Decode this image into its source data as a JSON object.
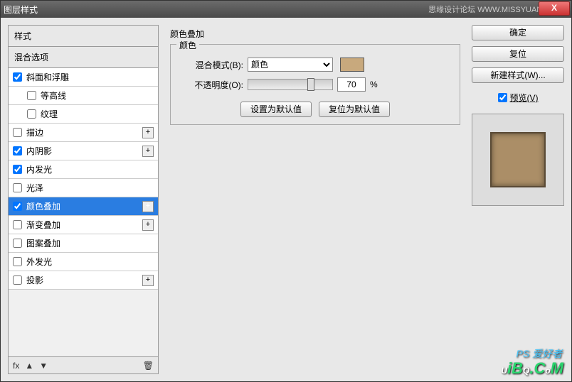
{
  "titlebar": {
    "title": "图层样式",
    "brand": "思缘设计论坛  WWW.MISSYUAN.COM",
    "close": "X"
  },
  "left": {
    "header": "样式",
    "blendopt": "混合选项",
    "items": [
      {
        "label": "斜面和浮雕",
        "checked": true,
        "add": false
      },
      {
        "label": "等高线",
        "checked": false,
        "add": false,
        "indent": true
      },
      {
        "label": "纹理",
        "checked": false,
        "add": false,
        "indent": true
      },
      {
        "label": "描边",
        "checked": false,
        "add": true
      },
      {
        "label": "内阴影",
        "checked": true,
        "add": true
      },
      {
        "label": "内发光",
        "checked": true,
        "add": false
      },
      {
        "label": "光泽",
        "checked": false,
        "add": false
      },
      {
        "label": "颜色叠加",
        "checked": true,
        "add": true,
        "selected": true
      },
      {
        "label": "渐变叠加",
        "checked": false,
        "add": true
      },
      {
        "label": "图案叠加",
        "checked": false,
        "add": false
      },
      {
        "label": "外发光",
        "checked": false,
        "add": false
      },
      {
        "label": "投影",
        "checked": false,
        "add": true
      }
    ],
    "foot": {
      "fx": "fx",
      "up": "▲",
      "down": "▼",
      "trash": "🗑"
    }
  },
  "mid": {
    "title": "颜色叠加",
    "legend": "颜色",
    "blend_label": "混合模式(B):",
    "blend_value": "颜色",
    "opacity_label": "不透明度(O):",
    "opacity_value": "70",
    "pct": "%",
    "set_default": "设置为默认值",
    "reset_default": "复位为默认值",
    "swatch_color": "#c8a97d"
  },
  "right": {
    "ok": "确定",
    "cancel": "复位",
    "newstyle": "新建样式(W)...",
    "preview_label": "预览(V)",
    "preview_checked": true
  },
  "wm1": "PS 爱好者",
  "wm2": "UiBQ.CoM"
}
